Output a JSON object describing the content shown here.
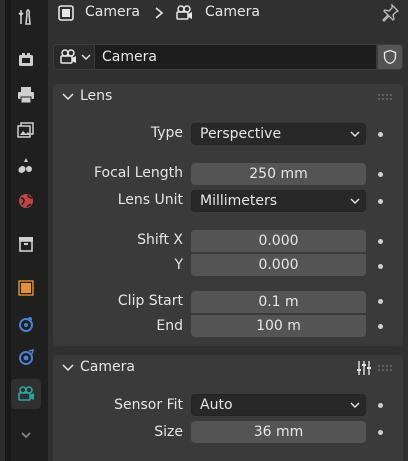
{
  "header": {
    "context": "Camera",
    "object": "Camera"
  },
  "datablock": {
    "name": "Camera"
  },
  "lens_panel": {
    "title": "Lens",
    "type": {
      "label": "Type",
      "value": "Perspective"
    },
    "focal_length": {
      "label": "Focal Length",
      "value": "250 mm"
    },
    "lens_unit": {
      "label": "Lens Unit",
      "value": "Millimeters"
    },
    "shift_x": {
      "label": "Shift X",
      "value": "0.000"
    },
    "shift_y": {
      "label": "Y",
      "value": "0.000"
    },
    "clip_start": {
      "label": "Clip Start",
      "value": "0.1 m"
    },
    "clip_end": {
      "label": "End",
      "value": "100 m"
    }
  },
  "camera_panel": {
    "title": "Camera",
    "sensor_fit": {
      "label": "Sensor Fit",
      "value": "Auto"
    },
    "size": {
      "label": "Size",
      "value": "36 mm"
    }
  },
  "sidebar": {
    "tabs": [
      {
        "name": "tool-icon"
      },
      {
        "name": "render-icon"
      },
      {
        "name": "output-icon"
      },
      {
        "name": "view-layer-icon"
      },
      {
        "name": "scene-icon"
      },
      {
        "name": "world-icon"
      },
      {
        "name": "collection-icon"
      },
      {
        "name": "object-icon"
      },
      {
        "name": "modifier-icon"
      },
      {
        "name": "physics-icon"
      },
      {
        "name": "camera-data-icon",
        "active": true
      },
      {
        "name": "chevron-down-icon"
      }
    ]
  },
  "colors": {
    "accent_teal": "#2ea5a5",
    "accent_orange": "#e69138",
    "accent_blue": "#4b7fd6",
    "accent_red": "#d54a4a"
  }
}
